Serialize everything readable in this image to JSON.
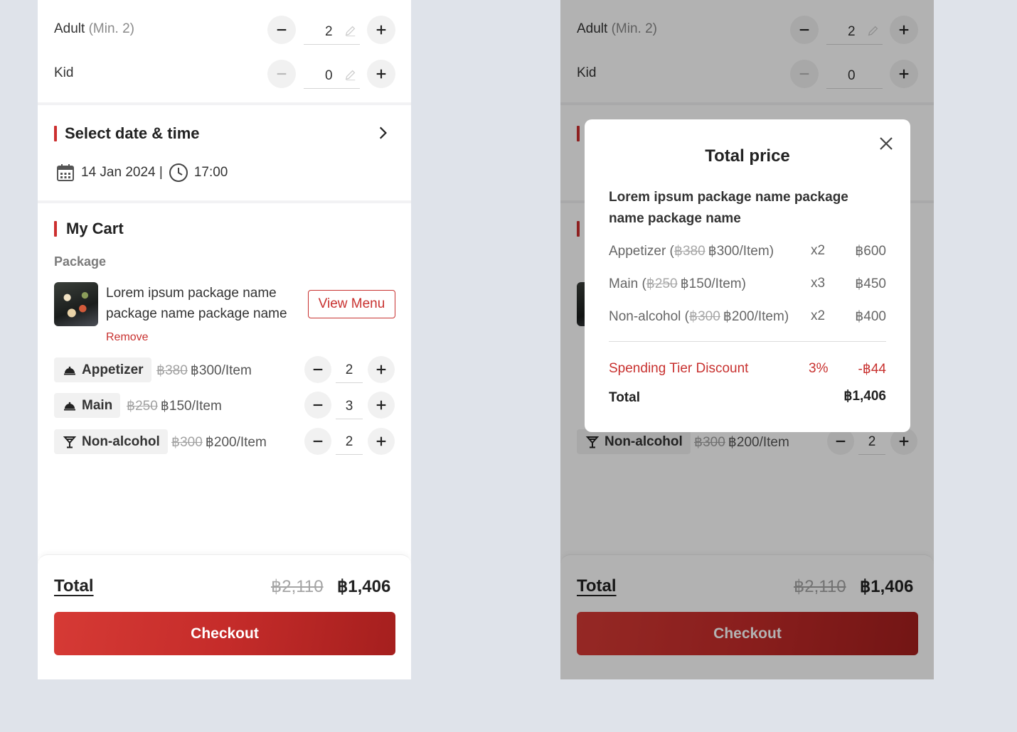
{
  "guests": {
    "adult_label": "Adult",
    "adult_min": "(Min. 2)",
    "adult_qty": "2",
    "kid_label": "Kid",
    "kid_qty": "0"
  },
  "datetime": {
    "title": "Select date & time",
    "date": "14 Jan 2024 |",
    "time": "17:00"
  },
  "cart": {
    "title": "My Cart",
    "package_heading": "Package",
    "package_name": "Lorem ipsum package name package name package name",
    "remove_label": "Remove",
    "view_menu_label": "View Menu",
    "items": [
      {
        "name": "Appetizer",
        "old_price": "฿380",
        "price": "฿300/Item",
        "qty": "2",
        "icon": "food-cloche-icon"
      },
      {
        "name": "Main",
        "old_price": "฿250",
        "price": "฿150/Item",
        "qty": "3",
        "icon": "food-cloche-icon"
      },
      {
        "name": "Non-alcohol",
        "old_price": "฿300",
        "price": "฿200/Item",
        "qty": "2",
        "icon": "cocktail-glass-icon"
      }
    ]
  },
  "footer": {
    "total_label": "Total",
    "total_old": "฿2,110",
    "total_new": "฿1,406",
    "checkout_label": "Checkout"
  },
  "modal": {
    "title": "Total price",
    "package_name": "Lorem ipsum package name package name package name",
    "rows": [
      {
        "label_pre": "Appetizer (",
        "old": "฿380",
        "price": "฿300/Item)",
        "qty": "x2",
        "amount": "฿600"
      },
      {
        "label_pre": "Main (",
        "old": "฿250",
        "price": "฿150/Item)",
        "qty": "x3",
        "amount": "฿450"
      },
      {
        "label_pre": "Non-alcohol (",
        "old": "฿300",
        "price": "฿200/Item)",
        "qty": "x2",
        "amount": "฿400"
      }
    ],
    "discount_label": "Spending Tier Discount",
    "discount_pct": "3%",
    "discount_amount": "-฿44",
    "total_label": "Total",
    "total_amount": "฿1,406"
  },
  "colors": {
    "accent": "#c8312f",
    "page_bg": "#dfe3ea",
    "chip_bg": "#f1f1f1"
  }
}
